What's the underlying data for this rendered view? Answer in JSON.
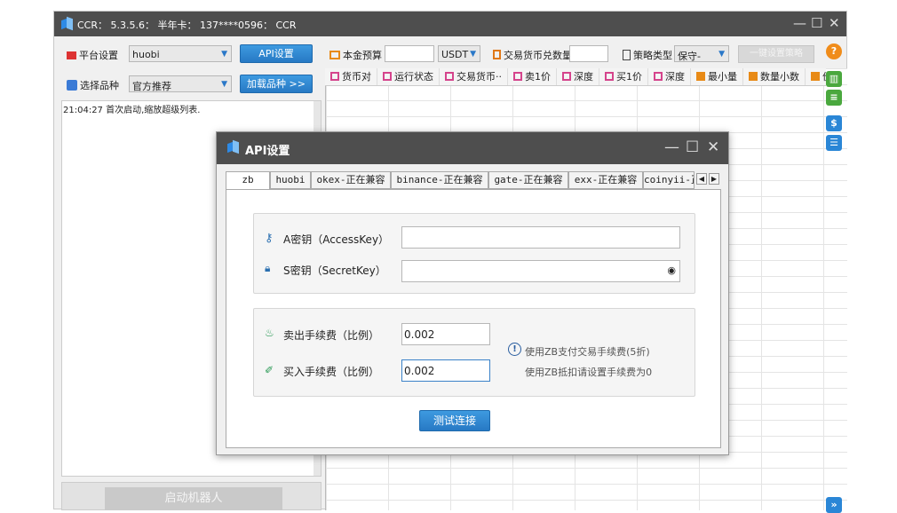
{
  "main_window": {
    "title": "CCR： 5.3.5.6： 半年卡： 137****0596： CCR",
    "minimize": "—",
    "maximize": "☐",
    "close": "✕"
  },
  "left_panel": {
    "platform_label": "平台设置",
    "platform_value": "huobi",
    "api_button": "API设置",
    "variety_label": "选择品种",
    "variety_value": "官方推荐",
    "load_button": "加载品种 >>",
    "log_text": "21:04:27 首次启动,缩放超级列表.",
    "start_button": "启动机器人"
  },
  "toolbar": {
    "budget_label": "本金预算",
    "budget_value": "",
    "currency_value": "USDT",
    "exchange_qty_label": "交易货币兑数量",
    "exchange_qty_value": "",
    "strategy_type_label": "策略类型",
    "strategy_type_value": "保守-",
    "one_click_button": "一键设置策略",
    "help_icon": "?"
  },
  "grid_headers": [
    "货币对",
    "运行状态",
    "交易货币··",
    "卖1价",
    "深度",
    "买1价",
    "深度",
    "最小量",
    "数量小数",
    "价格"
  ],
  "dialog": {
    "title": "API设置",
    "minimize": "—",
    "maximize": "☐",
    "close": "✕",
    "tabs": [
      "zb",
      "huobi",
      "okex-正在兼容",
      "binance-正在兼容",
      "gate-正在兼容",
      "exx-正在兼容",
      "coinyii-正"
    ],
    "active_tab": "zb",
    "access_key_label": "A密钥（AccessKey）",
    "access_key_value": "",
    "secret_key_label": "S密钥（SecretKey）",
    "secret_key_value": "",
    "sell_fee_label": "卖出手续费（比例）",
    "sell_fee_value": "0.002",
    "buy_fee_label": "买入手续费（比例）",
    "buy_fee_value": "0.002",
    "fee_note1": "使用ZB支付交易手续费(5折)",
    "fee_note2": "使用ZB抵扣请设置手续费为0",
    "test_button": "测试连接"
  },
  "colors": {
    "titlebar": "#4e4e4e",
    "accent_blue": "#2a86d6",
    "help_orange": "#f08c1a",
    "side_green": "#4aa83e"
  }
}
